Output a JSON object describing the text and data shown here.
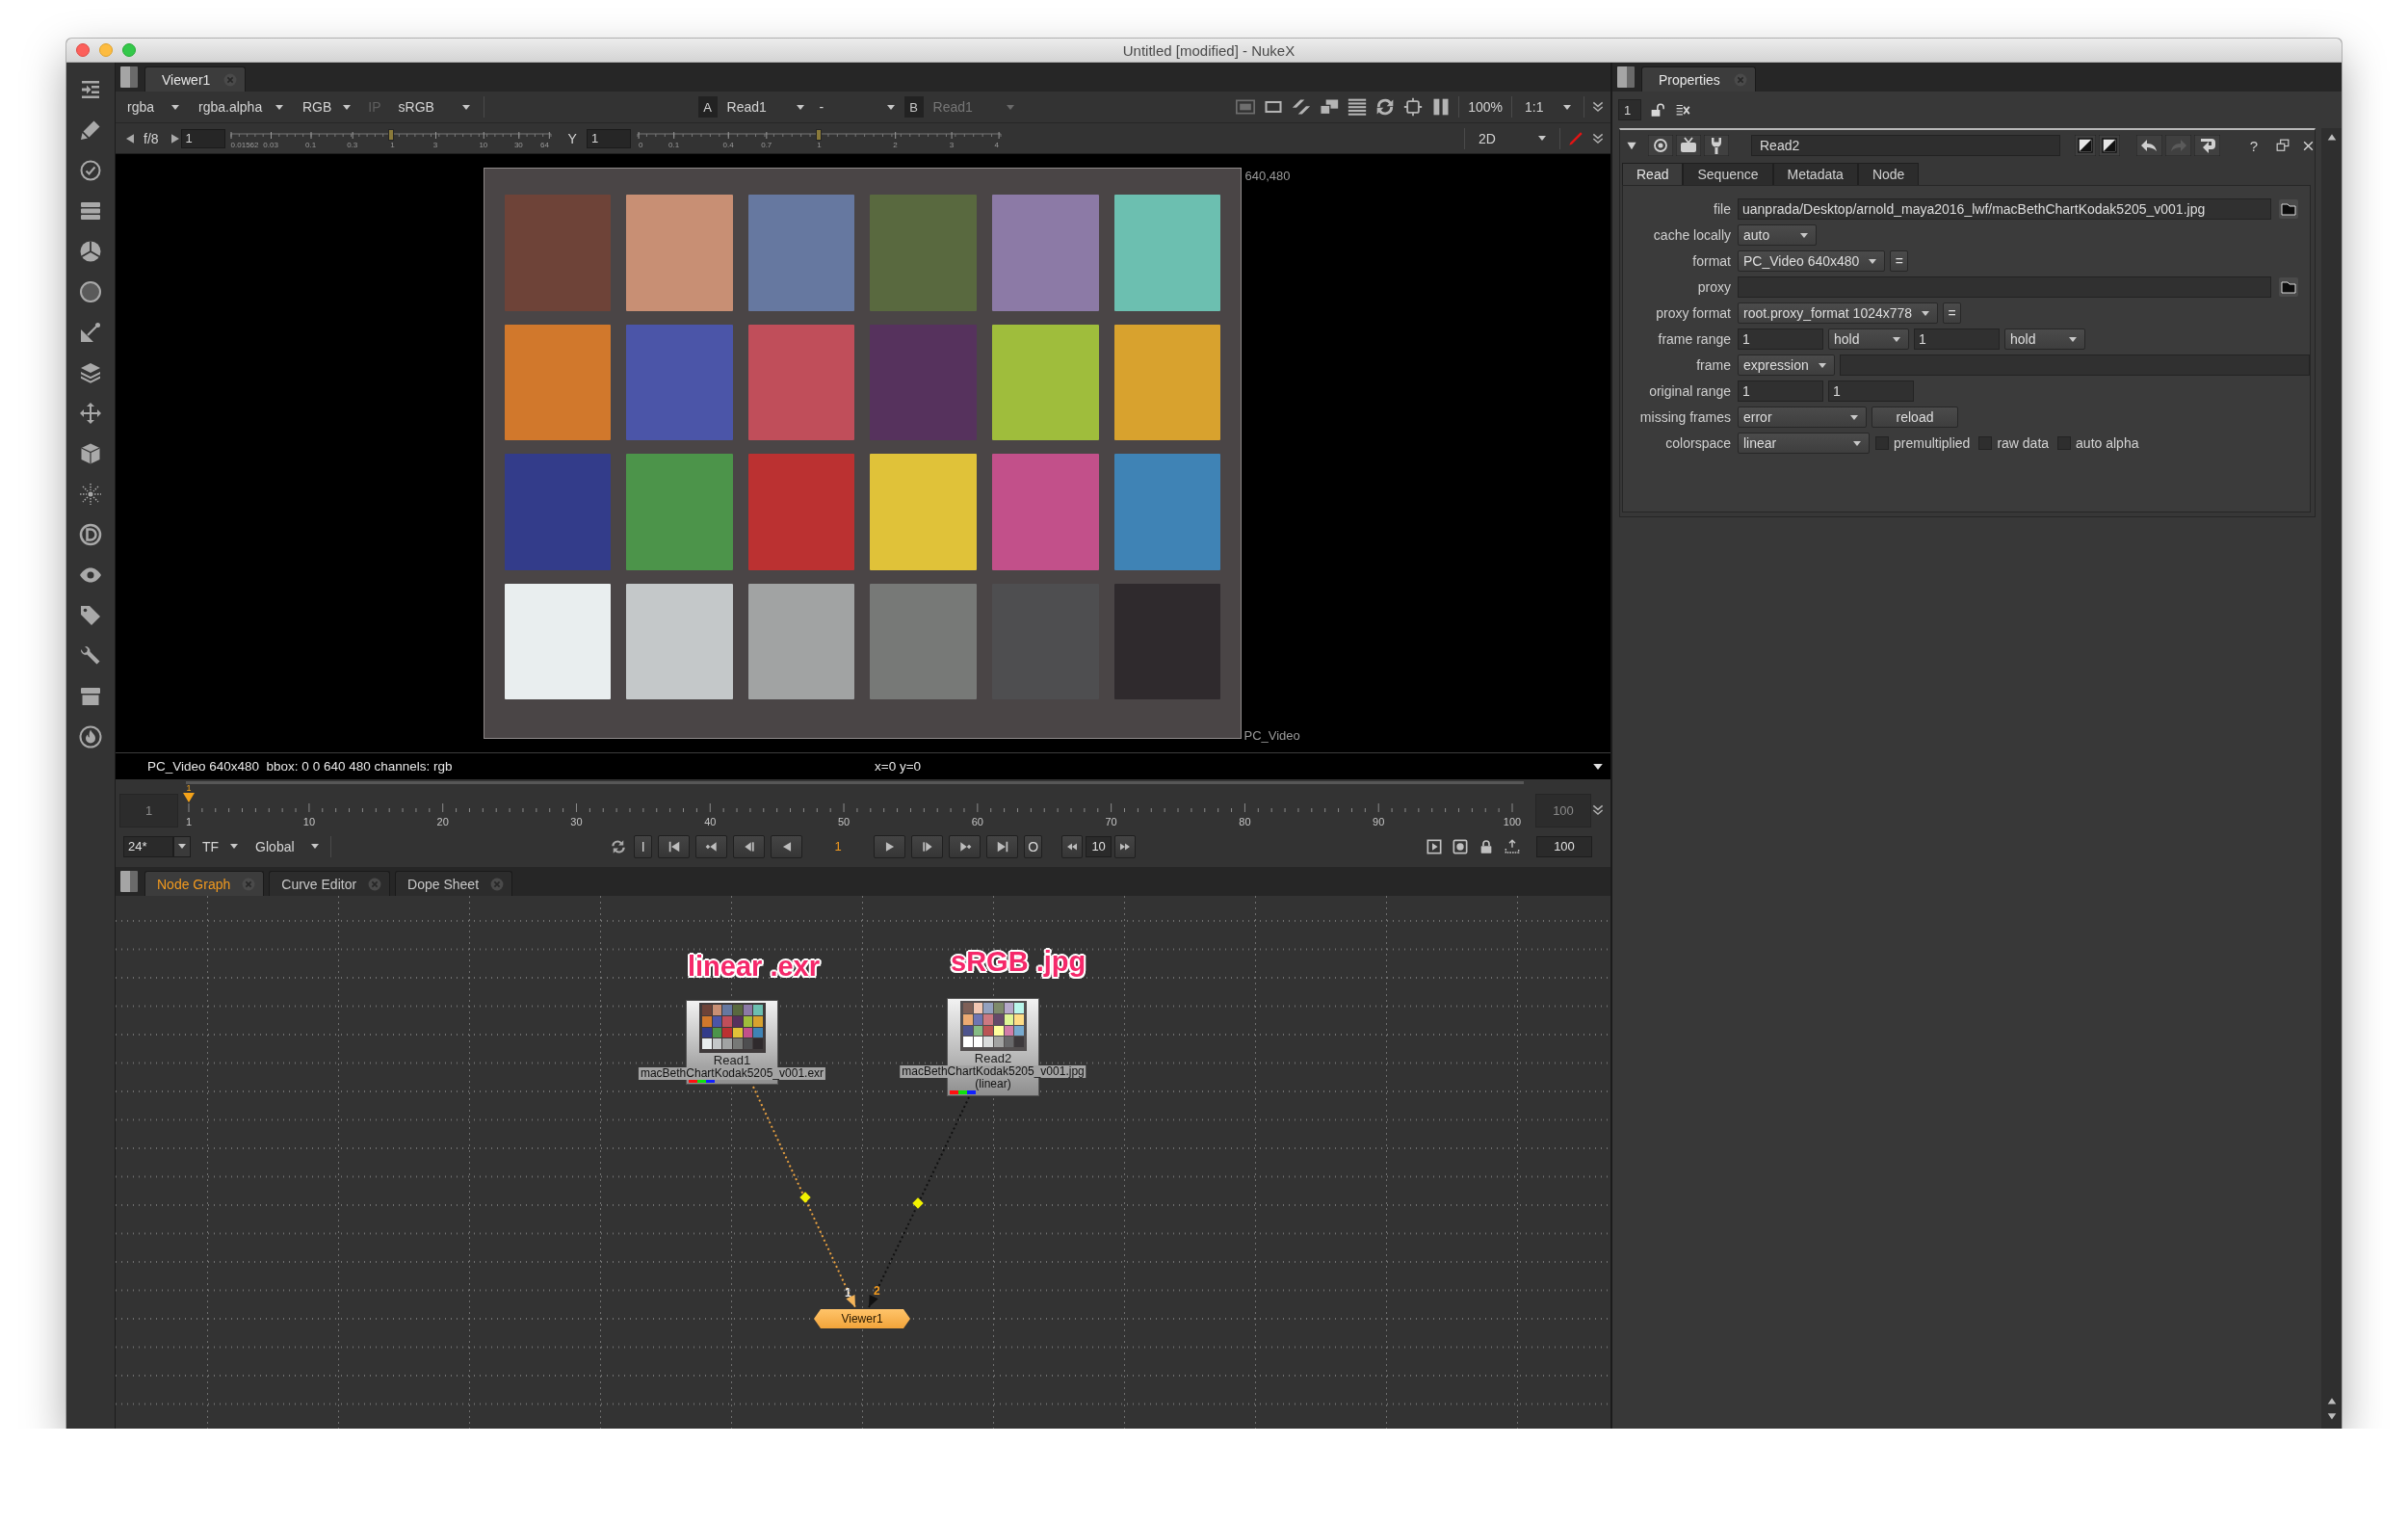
{
  "window": {
    "title": "Untitled [modified] - NukeX"
  },
  "viewer": {
    "tabs": [
      {
        "label": "Viewer1",
        "selected": true
      }
    ],
    "channels": "rgba",
    "alpha_channel": "rgba.alpha",
    "display": "RGB",
    "ip": {
      "label": "IP",
      "disabled": true
    },
    "lut": "sRGB",
    "input_a": {
      "letter": "A",
      "value": "Read1",
      "disabled": false
    },
    "wipe": "-",
    "input_b": {
      "letter": "B",
      "value": "Read1",
      "disabled": true
    },
    "zoom": "100%",
    "pixel_ratio": "1:1",
    "gain": {
      "label": "f/8",
      "value": "1",
      "level": 0.5,
      "ticks": [
        "0.01562",
        "0.03",
        "0.1",
        "0.3",
        "1",
        "3",
        "10",
        "30",
        "64"
      ]
    },
    "gamma": {
      "label": "Y",
      "value": "1",
      "level": 0.5,
      "ticks": [
        "0",
        "0.1",
        "0.4",
        "0.7",
        "1",
        "2",
        "3",
        "4"
      ]
    },
    "mode": "2D",
    "image": {
      "corner_label": "640,480",
      "format_label": "PC_Video"
    },
    "info": {
      "format": "PC_Video 640x480  bbox: 0 0 640 480 channels: rgb",
      "cursor": "x=0 y=0"
    }
  },
  "timeline": {
    "start": "1",
    "end": "100",
    "playhead": "1",
    "level": 0,
    "ticks": [
      "1",
      "10",
      "20",
      "30",
      "40",
      "50",
      "60",
      "70",
      "80",
      "90",
      "100"
    ]
  },
  "playback": {
    "fps": "24*",
    "time_format": "TF",
    "range": "Global",
    "in_point": "I",
    "frame": "1",
    "out_point": "O",
    "step": "10",
    "last_frame": "100"
  },
  "panel_tabs": [
    {
      "label": "Node Graph",
      "selected": true
    },
    {
      "label": "Curve Editor",
      "selected": false
    },
    {
      "label": "Dope Sheet",
      "selected": false
    }
  ],
  "node_graph": {
    "notes": [
      "linear .exr",
      "sRGB .jpg"
    ],
    "nodes": [
      {
        "kind": "read",
        "name": "Read1",
        "lines": [
          "macBethChartKodak5205_v001.exr"
        ]
      },
      {
        "kind": "read",
        "name": "Read2",
        "lines": [
          "macBethChartKodak5205_v001.jpg",
          "(linear)"
        ]
      },
      {
        "kind": "viewer",
        "name": "Viewer1"
      }
    ],
    "edges": [
      {
        "input": "1",
        "active": true
      },
      {
        "input": "2",
        "active": false
      }
    ]
  },
  "properties": {
    "tabs": [
      {
        "label": "Properties",
        "selected": true
      }
    ],
    "max_panels": "1",
    "node_name": "Read2",
    "help": "?",
    "knob_tabs": [
      {
        "label": "Read",
        "selected": true
      },
      {
        "label": "Sequence",
        "selected": false
      },
      {
        "label": "Metadata",
        "selected": false
      },
      {
        "label": "Node",
        "selected": false
      }
    ],
    "knobs": [
      {
        "label": "file",
        "widgets": [
          {
            "kind": "long_field",
            "value": "uanprada/Desktop/arnold_maya2016_lwf/macBethChartKodak5205_v001.jpg"
          },
          {
            "kind": "browse"
          }
        ]
      },
      {
        "label": "cache locally",
        "widgets": [
          {
            "kind": "menu",
            "value": "auto"
          }
        ]
      },
      {
        "label": "format",
        "widgets": [
          {
            "kind": "menu",
            "value": "PC_Video 640x480"
          },
          {
            "kind": "button",
            "label": "="
          }
        ]
      },
      {
        "label": "proxy",
        "widgets": [
          {
            "kind": "long_field"
          },
          {
            "kind": "browse"
          }
        ]
      },
      {
        "label": "proxy format",
        "widgets": [
          {
            "kind": "menu",
            "value": "root.proxy_format 1024x778"
          },
          {
            "kind": "button",
            "label": "="
          }
        ]
      },
      {
        "label": "frame range",
        "widgets": [
          {
            "kind": "field",
            "value": "1"
          },
          {
            "kind": "menu",
            "value": "hold"
          },
          {
            "kind": "field",
            "value": "1"
          },
          {
            "kind": "menu",
            "value": "hold"
          }
        ]
      },
      {
        "label": "frame",
        "widgets": [
          {
            "kind": "menu",
            "value": "expression"
          },
          {
            "kind": "long_field"
          }
        ]
      },
      {
        "label": "original range",
        "widgets": [
          {
            "kind": "field",
            "value": "1"
          },
          {
            "kind": "field",
            "value": "1"
          }
        ]
      },
      {
        "label": "missing frames",
        "widgets": [
          {
            "kind": "menu",
            "value": "error"
          },
          {
            "kind": "button",
            "label": "reload"
          }
        ]
      },
      {
        "label": "colorspace",
        "widgets": [
          {
            "kind": "menu",
            "value": "linear"
          },
          {
            "kind": "check",
            "label": "premultiplied",
            "checked": false
          },
          {
            "kind": "check",
            "label": "raw data",
            "checked": false
          },
          {
            "kind": "check",
            "label": "auto alpha",
            "checked": false
          }
        ]
      }
    ]
  }
}
